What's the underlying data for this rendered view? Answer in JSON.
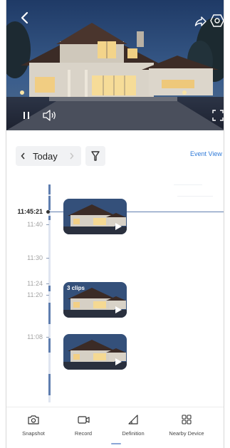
{
  "video": {
    "controls": {
      "back_icon": "chevron-left-icon",
      "share_icon": "share-icon",
      "settings_icon": "hexagon-gear-icon",
      "pause_icon": "pause-icon",
      "volume_icon": "volume-icon",
      "fullscreen_icon": "fullscreen-icon"
    }
  },
  "date_nav": {
    "prev_icon": "chevron-left-icon",
    "label": "Today",
    "next_icon": "chevron-right-icon",
    "filter_icon": "filter-icon",
    "event_view_label": "Event View"
  },
  "timeline": {
    "current_time": "11:45:21",
    "times": [
      "11:40",
      "11:30",
      "11:24",
      "11:20",
      "11:08"
    ],
    "clips": [
      {
        "label": ""
      },
      {
        "label": "3 clips"
      },
      {
        "label": ""
      }
    ]
  },
  "toolbar": {
    "items": [
      {
        "label": "Snapshot",
        "icon": "camera-icon"
      },
      {
        "label": "Record",
        "icon": "video-record-icon"
      },
      {
        "label": "Definition",
        "icon": "definition-icon"
      },
      {
        "label": "Nearby Device",
        "icon": "grid-icon"
      }
    ]
  },
  "colors": {
    "accent": "#2f7ad8",
    "timeline_axis": "#5f7eaf",
    "pill_bg": "#f1f2f4"
  }
}
